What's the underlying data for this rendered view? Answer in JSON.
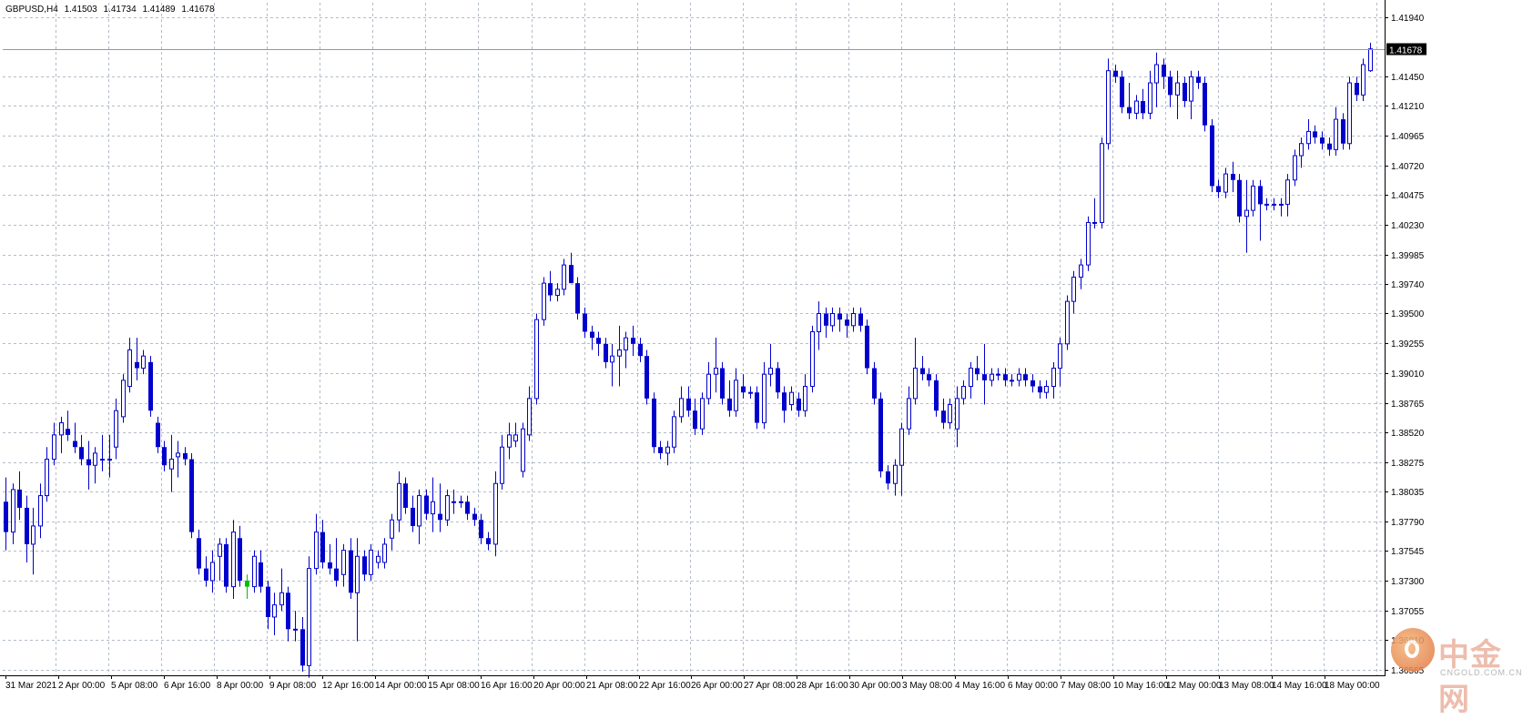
{
  "window": {
    "symbol": "GBPUSD,H4",
    "ohlc": [
      "1.41503",
      "1.41734",
      "1.41489",
      "1.41678"
    ]
  },
  "chart_data": {
    "type": "candlestick",
    "symbol": "GBPUSD",
    "timeframe": "H4",
    "current_price": 1.41678,
    "price_label": "1.41678",
    "ylim": [
      1.3652,
      1.4206
    ],
    "price_ticks": [
      "1.41940",
      "1.41450",
      "1.41210",
      "1.40965",
      "1.40720",
      "1.40475",
      "1.40230",
      "1.39985",
      "1.39740",
      "1.39500",
      "1.39255",
      "1.39010",
      "1.38765",
      "1.38520",
      "1.38275",
      "1.38035",
      "1.37790",
      "1.37545",
      "1.37300",
      "1.37055",
      "1.36810",
      "1.36565"
    ],
    "x_labels": [
      "31 Mar 2021",
      "2 Apr 00:00",
      "5 Apr 08:00",
      "6 Apr 16:00",
      "8 Apr 00:00",
      "9 Apr 08:00",
      "12 Apr 16:00",
      "14 Apr 00:00",
      "15 Apr 08:00",
      "16 Apr 16:00",
      "20 Apr 00:00",
      "21 Apr 08:00",
      "22 Apr 16:00",
      "26 Apr 00:00",
      "27 Apr 08:00",
      "28 Apr 16:00",
      "30 Apr 00:00",
      "3 May 08:00",
      "4 May 16:00",
      "6 May 00:00",
      "7 May 08:00",
      "10 May 16:00",
      "12 May 00:00",
      "13 May 08:00",
      "14 May 16:00",
      "18 May 00:00"
    ],
    "grid": true,
    "colors": {
      "bull": "#0000cc",
      "bear": "#0000cc",
      "grid": "#b4bcc8",
      "axis": "#000000",
      "price_line": "#8a9aaa",
      "price_label_bg": "#000000",
      "price_label_text": "#ffffff",
      "highlight_candle": "#00c000"
    },
    "candles": [
      [
        1.3795,
        1.3815,
        1.3755,
        1.377
      ],
      [
        1.377,
        1.381,
        1.376,
        1.3805
      ],
      [
        1.3805,
        1.382,
        1.378,
        1.379
      ],
      [
        1.379,
        1.38,
        1.3745,
        1.376
      ],
      [
        1.376,
        1.379,
        1.3735,
        1.3775
      ],
      [
        1.3775,
        1.381,
        1.3765,
        1.38
      ],
      [
        1.38,
        1.384,
        1.3795,
        1.383
      ],
      [
        1.383,
        1.386,
        1.3825,
        1.385
      ],
      [
        1.385,
        1.3865,
        1.3835,
        1.386
      ],
      [
        1.3855,
        1.387,
        1.3845,
        1.385
      ],
      [
        1.3845,
        1.386,
        1.3835,
        1.384
      ],
      [
        1.384,
        1.385,
        1.3825,
        1.383
      ],
      [
        1.383,
        1.3845,
        1.3805,
        1.3825
      ],
      [
        1.3825,
        1.384,
        1.381,
        1.3835
      ],
      [
        1.383,
        1.385,
        1.382,
        1.383
      ],
      [
        1.383,
        1.385,
        1.3815,
        1.383
      ],
      [
        1.384,
        1.388,
        1.383,
        1.387
      ],
      [
        1.3865,
        1.39,
        1.386,
        1.3895
      ],
      [
        1.389,
        1.393,
        1.3885,
        1.392
      ],
      [
        1.391,
        1.393,
        1.3895,
        1.3905
      ],
      [
        1.3905,
        1.392,
        1.39,
        1.3915
      ],
      [
        1.391,
        1.3915,
        1.3865,
        1.387
      ],
      [
        1.386,
        1.3865,
        1.3835,
        1.384
      ],
      [
        1.384,
        1.3845,
        1.382,
        1.3825
      ],
      [
        1.3822,
        1.385,
        1.3803,
        1.383
      ],
      [
        1.3832,
        1.3845,
        1.3815,
        1.3835
      ],
      [
        1.3835,
        1.384,
        1.3825,
        1.383
      ],
      [
        1.383,
        1.3835,
        1.3765,
        1.377
      ],
      [
        1.3765,
        1.3772,
        1.3735,
        1.374
      ],
      [
        1.374,
        1.375,
        1.3725,
        1.373
      ],
      [
        1.373,
        1.3755,
        1.372,
        1.3745
      ],
      [
        1.375,
        1.3765,
        1.373,
        1.376
      ],
      [
        1.376,
        1.3765,
        1.372,
        1.3725
      ],
      [
        1.3725,
        1.378,
        1.3715,
        1.377
      ],
      [
        1.3765,
        1.3775,
        1.3725,
        1.373
      ],
      [
        1.373,
        1.3735,
        1.3715,
        1.3725
      ],
      [
        1.3725,
        1.3755,
        1.372,
        1.375
      ],
      [
        1.3745,
        1.3755,
        1.372,
        1.3725
      ],
      [
        1.3725,
        1.373,
        1.369,
        1.37
      ],
      [
        1.37,
        1.372,
        1.3685,
        1.371
      ],
      [
        1.371,
        1.374,
        1.3705,
        1.372
      ],
      [
        1.372,
        1.3725,
        1.368,
        1.369
      ],
      [
        1.369,
        1.3705,
        1.368,
        1.369
      ],
      [
        1.369,
        1.37,
        1.3655,
        1.366
      ],
      [
        1.366,
        1.375,
        1.365,
        1.374
      ],
      [
        1.374,
        1.3785,
        1.3735,
        1.377
      ],
      [
        1.377,
        1.378,
        1.374,
        1.3745
      ],
      [
        1.3745,
        1.376,
        1.3735,
        1.374
      ],
      [
        1.374,
        1.3765,
        1.3725,
        1.373
      ],
      [
        1.3735,
        1.376,
        1.3725,
        1.3755
      ],
      [
        1.3755,
        1.3765,
        1.3715,
        1.372
      ],
      [
        1.372,
        1.3765,
        1.368,
        1.375
      ],
      [
        1.375,
        1.3755,
        1.373,
        1.3735
      ],
      [
        1.3735,
        1.376,
        1.373,
        1.3755
      ],
      [
        1.3745,
        1.3755,
        1.374,
        1.375
      ],
      [
        1.3745,
        1.3765,
        1.374,
        1.376
      ],
      [
        1.3765,
        1.3785,
        1.3755,
        1.378
      ],
      [
        1.378,
        1.382,
        1.377,
        1.381
      ],
      [
        1.381,
        1.3815,
        1.3785,
        1.379
      ],
      [
        1.379,
        1.38,
        1.377,
        1.3775
      ],
      [
        1.3775,
        1.3805,
        1.376,
        1.38
      ],
      [
        1.38,
        1.3805,
        1.378,
        1.3785
      ],
      [
        1.3785,
        1.3815,
        1.377,
        1.3795
      ],
      [
        1.3785,
        1.381,
        1.377,
        1.378
      ],
      [
        1.378,
        1.3805,
        1.3775,
        1.38
      ],
      [
        1.3795,
        1.3805,
        1.3785,
        1.3795
      ],
      [
        1.3795,
        1.38,
        1.379,
        1.3795
      ],
      [
        1.3795,
        1.38,
        1.378,
        1.3785
      ],
      [
        1.3785,
        1.379,
        1.3775,
        1.378
      ],
      [
        1.378,
        1.3785,
        1.376,
        1.3765
      ],
      [
        1.3765,
        1.377,
        1.3755,
        1.376
      ],
      [
        1.376,
        1.382,
        1.375,
        1.381
      ],
      [
        1.381,
        1.385,
        1.3805,
        1.384
      ],
      [
        1.384,
        1.386,
        1.383,
        1.385
      ],
      [
        1.3845,
        1.386,
        1.384,
        1.385
      ],
      [
        1.382,
        1.386,
        1.3815,
        1.3855
      ],
      [
        1.385,
        1.389,
        1.3845,
        1.388
      ],
      [
        1.388,
        1.395,
        1.3875,
        1.3945
      ],
      [
        1.3945,
        1.398,
        1.394,
        1.3975
      ],
      [
        1.3975,
        1.3985,
        1.396,
        1.3965
      ],
      [
        1.3965,
        1.3975,
        1.396,
        1.397
      ],
      [
        1.397,
        1.3995,
        1.3965,
        1.399
      ],
      [
        1.399,
        1.4,
        1.3975,
        1.3975
      ],
      [
        1.3975,
        1.398,
        1.3945,
        1.395
      ],
      [
        1.395,
        1.3955,
        1.393,
        1.3935
      ],
      [
        1.3935,
        1.394,
        1.392,
        1.393
      ],
      [
        1.393,
        1.3935,
        1.3915,
        1.3925
      ],
      [
        1.3925,
        1.393,
        1.3905,
        1.391
      ],
      [
        1.391,
        1.3925,
        1.389,
        1.3915
      ],
      [
        1.3915,
        1.394,
        1.389,
        1.392
      ],
      [
        1.392,
        1.3935,
        1.3905,
        1.393
      ],
      [
        1.393,
        1.394,
        1.3915,
        1.3925
      ],
      [
        1.3925,
        1.393,
        1.391,
        1.3915
      ],
      [
        1.3915,
        1.392,
        1.3875,
        1.388
      ],
      [
        1.388,
        1.3885,
        1.3835,
        1.384
      ],
      [
        1.384,
        1.3845,
        1.383,
        1.3835
      ],
      [
        1.3835,
        1.3845,
        1.3825,
        1.384
      ],
      [
        1.384,
        1.387,
        1.3835,
        1.3865
      ],
      [
        1.3865,
        1.389,
        1.386,
        1.388
      ],
      [
        1.388,
        1.389,
        1.3865,
        1.387
      ],
      [
        1.387,
        1.388,
        1.385,
        1.3855
      ],
      [
        1.3855,
        1.3885,
        1.385,
        1.388
      ],
      [
        1.388,
        1.391,
        1.3875,
        1.39
      ],
      [
        1.39,
        1.393,
        1.3885,
        1.3905
      ],
      [
        1.3905,
        1.391,
        1.3875,
        1.388
      ],
      [
        1.388,
        1.3895,
        1.3865,
        1.387
      ],
      [
        1.387,
        1.3905,
        1.3865,
        1.3895
      ],
      [
        1.389,
        1.39,
        1.388,
        1.3885
      ],
      [
        1.3885,
        1.389,
        1.388,
        1.3885
      ],
      [
        1.3885,
        1.389,
        1.3855,
        1.386
      ],
      [
        1.386,
        1.391,
        1.3855,
        1.39
      ],
      [
        1.39,
        1.3925,
        1.389,
        1.3905
      ],
      [
        1.3905,
        1.391,
        1.388,
        1.3885
      ],
      [
        1.3885,
        1.389,
        1.386,
        1.387
      ],
      [
        1.3875,
        1.389,
        1.387,
        1.3885
      ],
      [
        1.388,
        1.3885,
        1.3865,
        1.387
      ],
      [
        1.387,
        1.39,
        1.3865,
        1.389
      ],
      [
        1.389,
        1.394,
        1.3885,
        1.3935
      ],
      [
        1.3935,
        1.396,
        1.392,
        1.395
      ],
      [
        1.395,
        1.3955,
        1.393,
        1.394
      ],
      [
        1.394,
        1.3955,
        1.3935,
        1.395
      ],
      [
        1.395,
        1.3955,
        1.3935,
        1.3945
      ],
      [
        1.3945,
        1.395,
        1.393,
        1.394
      ],
      [
        1.394,
        1.3955,
        1.3935,
        1.395
      ],
      [
        1.395,
        1.3955,
        1.3935,
        1.394
      ],
      [
        1.394,
        1.3945,
        1.39,
        1.3905
      ],
      [
        1.3905,
        1.391,
        1.3875,
        1.388
      ],
      [
        1.388,
        1.3885,
        1.3815,
        1.382
      ],
      [
        1.382,
        1.3825,
        1.3805,
        1.381
      ],
      [
        1.381,
        1.383,
        1.38,
        1.3825
      ],
      [
        1.3825,
        1.386,
        1.38,
        1.3855
      ],
      [
        1.3855,
        1.389,
        1.385,
        1.388
      ],
      [
        1.388,
        1.393,
        1.3875,
        1.3905
      ],
      [
        1.3905,
        1.3915,
        1.3895,
        1.39
      ],
      [
        1.39,
        1.3905,
        1.389,
        1.3895
      ],
      [
        1.3895,
        1.39,
        1.3865,
        1.387
      ],
      [
        1.387,
        1.388,
        1.3855,
        1.386
      ],
      [
        1.386,
        1.388,
        1.3855,
        1.3875
      ],
      [
        1.3855,
        1.389,
        1.384,
        1.388
      ],
      [
        1.388,
        1.3895,
        1.3875,
        1.389
      ],
      [
        1.389,
        1.391,
        1.388,
        1.3905
      ],
      [
        1.3905,
        1.3915,
        1.3895,
        1.39
      ],
      [
        1.39,
        1.3925,
        1.3875,
        1.3895
      ],
      [
        1.3895,
        1.3905,
        1.389,
        1.39
      ],
      [
        1.39,
        1.3905,
        1.3895,
        1.39
      ],
      [
        1.39,
        1.3905,
        1.389,
        1.3895
      ],
      [
        1.3895,
        1.39,
        1.389,
        1.3895
      ],
      [
        1.3895,
        1.3905,
        1.389,
        1.39
      ],
      [
        1.39,
        1.3905,
        1.389,
        1.3895
      ],
      [
        1.3895,
        1.39,
        1.3885,
        1.389
      ],
      [
        1.389,
        1.3895,
        1.388,
        1.3885
      ],
      [
        1.3885,
        1.3895,
        1.388,
        1.389
      ],
      [
        1.389,
        1.391,
        1.388,
        1.3905
      ],
      [
        1.3905,
        1.393,
        1.389,
        1.3925
      ],
      [
        1.3925,
        1.3965,
        1.392,
        1.396
      ],
      [
        1.396,
        1.3985,
        1.395,
        1.398
      ],
      [
        1.398,
        1.3995,
        1.397,
        1.399
      ],
      [
        1.399,
        1.403,
        1.3985,
        1.4025
      ],
      [
        1.4025,
        1.4045,
        1.402,
        1.4025
      ],
      [
        1.4025,
        1.4095,
        1.402,
        1.409
      ],
      [
        1.409,
        1.416,
        1.4085,
        1.415
      ],
      [
        1.415,
        1.4155,
        1.414,
        1.4145
      ],
      [
        1.4145,
        1.415,
        1.4115,
        1.412
      ],
      [
        1.412,
        1.414,
        1.411,
        1.4115
      ],
      [
        1.4115,
        1.413,
        1.411,
        1.4125
      ],
      [
        1.4125,
        1.4135,
        1.411,
        1.4115
      ],
      [
        1.4115,
        1.415,
        1.411,
        1.414
      ],
      [
        1.414,
        1.4165,
        1.412,
        1.4155
      ],
      [
        1.4155,
        1.416,
        1.4135,
        1.4145
      ],
      [
        1.4145,
        1.415,
        1.412,
        1.413
      ],
      [
        1.413,
        1.415,
        1.411,
        1.414
      ],
      [
        1.414,
        1.4145,
        1.412,
        1.4125
      ],
      [
        1.4125,
        1.415,
        1.411,
        1.4145
      ],
      [
        1.4145,
        1.415,
        1.4135,
        1.414
      ],
      [
        1.414,
        1.4145,
        1.41,
        1.4105
      ],
      [
        1.4105,
        1.411,
        1.405,
        1.4055
      ],
      [
        1.4055,
        1.406,
        1.4045,
        1.405
      ],
      [
        1.405,
        1.407,
        1.4045,
        1.4065
      ],
      [
        1.4065,
        1.4075,
        1.405,
        1.406
      ],
      [
        1.406,
        1.4065,
        1.4025,
        1.403
      ],
      [
        1.403,
        1.406,
        1.4,
        1.4035
      ],
      [
        1.4035,
        1.406,
        1.403,
        1.4055
      ],
      [
        1.4055,
        1.406,
        1.401,
        1.404
      ],
      [
        1.404,
        1.4045,
        1.4035,
        1.404
      ],
      [
        1.404,
        1.4045,
        1.4035,
        1.404
      ],
      [
        1.404,
        1.4045,
        1.403,
        1.404
      ],
      [
        1.404,
        1.4065,
        1.403,
        1.406
      ],
      [
        1.406,
        1.4085,
        1.4055,
        1.408
      ],
      [
        1.408,
        1.4095,
        1.407,
        1.409
      ],
      [
        1.409,
        1.411,
        1.4085,
        1.41
      ],
      [
        1.41,
        1.4105,
        1.409,
        1.4095
      ],
      [
        1.4095,
        1.41,
        1.4085,
        1.409
      ],
      [
        1.409,
        1.4095,
        1.408,
        1.4085
      ],
      [
        1.4085,
        1.412,
        1.408,
        1.411
      ],
      [
        1.411,
        1.4115,
        1.4085,
        1.409
      ],
      [
        1.409,
        1.4145,
        1.4085,
        1.414
      ],
      [
        1.414,
        1.4145,
        1.4125,
        1.413
      ],
      [
        1.413,
        1.416,
        1.4125,
        1.4155
      ],
      [
        1.415,
        1.4173,
        1.4149,
        1.4168
      ]
    ]
  }
}
